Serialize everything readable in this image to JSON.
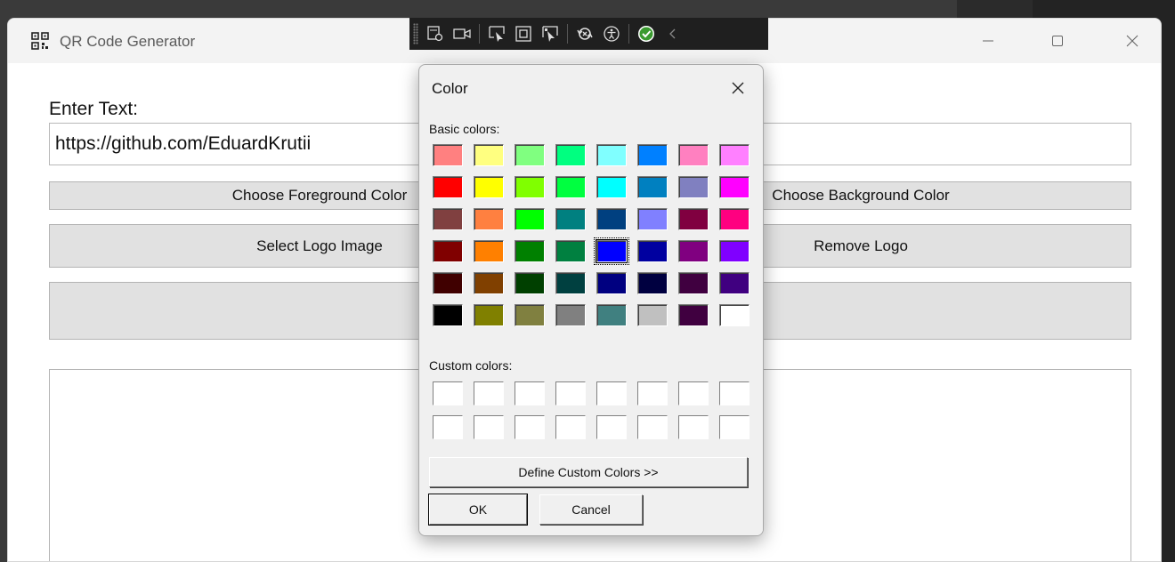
{
  "window": {
    "title": "QR Code Generator"
  },
  "form": {
    "enter_label": "Enter Text:",
    "text_value": "https://github.com/EduardKrutii",
    "choose_fg_label": "Choose Foreground Color",
    "choose_bg_label": "Choose Background Color",
    "select_logo_label": "Select Logo Image",
    "remove_logo_label": "Remove Logo",
    "generate_label": ""
  },
  "toolbar": {
    "items": [
      "select-element-icon",
      "record-video-icon",
      "pointer-select-icon",
      "frame-select-icon",
      "track-focus-icon",
      "hot-reload-icon",
      "accessibility-icon",
      "status-ok-icon",
      "collapse-chevron-icon"
    ]
  },
  "color_dialog": {
    "title": "Color",
    "basic_label": "Basic colors:",
    "custom_label": "Custom colors:",
    "define_label": "Define Custom Colors >>",
    "ok_label": "OK",
    "cancel_label": "Cancel",
    "selected_index": 28,
    "basic_colors": [
      "#ff8080",
      "#ffff80",
      "#80ff80",
      "#00ff80",
      "#80ffff",
      "#0080ff",
      "#ff80c0",
      "#ff80ff",
      "#ff0000",
      "#ffff00",
      "#80ff00",
      "#00ff40",
      "#00ffff",
      "#0080c0",
      "#8080c0",
      "#ff00ff",
      "#804040",
      "#ff8040",
      "#00ff00",
      "#008080",
      "#004080",
      "#8080ff",
      "#800040",
      "#ff0080",
      "#800000",
      "#ff8000",
      "#008000",
      "#008040",
      "#0000ff",
      "#0000a0",
      "#800080",
      "#8000ff",
      "#400000",
      "#804000",
      "#004000",
      "#004040",
      "#000080",
      "#000040",
      "#400040",
      "#400080",
      "#000000",
      "#808000",
      "#808040",
      "#808080",
      "#408080",
      "#c0c0c0",
      "#400040",
      "#ffffff"
    ],
    "custom_colors": [
      "#ffffff",
      "#ffffff",
      "#ffffff",
      "#ffffff",
      "#ffffff",
      "#ffffff",
      "#ffffff",
      "#ffffff",
      "#ffffff",
      "#ffffff",
      "#ffffff",
      "#ffffff",
      "#ffffff",
      "#ffffff",
      "#ffffff",
      "#ffffff"
    ]
  }
}
